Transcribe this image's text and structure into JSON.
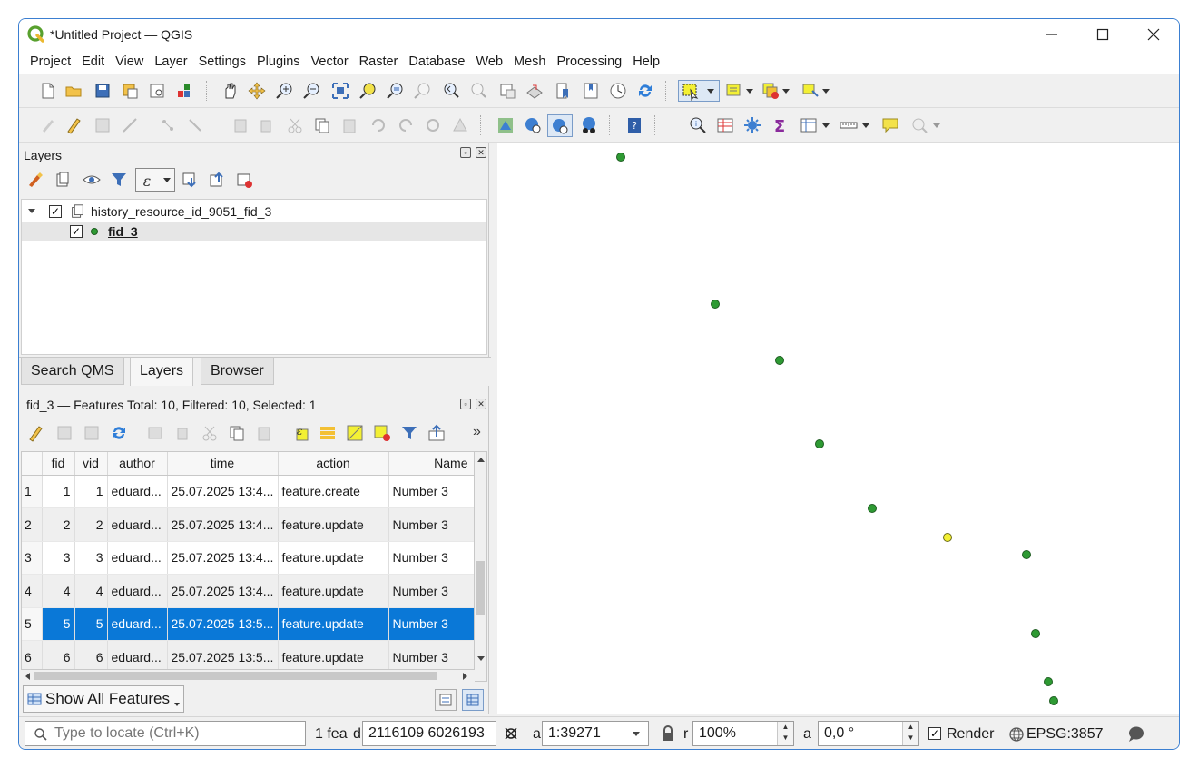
{
  "window": {
    "title": "*Untitled Project — QGIS"
  },
  "menubar": {
    "items": [
      "Project",
      "Edit",
      "View",
      "Layer",
      "Settings",
      "Plugins",
      "Vector",
      "Raster",
      "Database",
      "Web",
      "Mesh",
      "Processing",
      "Help"
    ]
  },
  "layers_panel": {
    "title": "Layers",
    "group": {
      "name": "history_resource_id_9051_fid_3",
      "checked": "✓"
    },
    "layer": {
      "name": "fid_3",
      "checked": "✓"
    }
  },
  "panel_tabs": [
    "Search QMS",
    "Layers",
    "Browser"
  ],
  "attribute_table": {
    "title": "fid_3 — Features Total: 10, Filtered: 10, Selected: 1",
    "columns": [
      "fid",
      "vid",
      "author",
      "time",
      "action",
      "Name"
    ],
    "rows": [
      {
        "row": "1",
        "fid": "1",
        "vid": "1",
        "author": "eduard...",
        "time": "25.07.2025 13:4...",
        "action": "feature.create",
        "name": "Number 3"
      },
      {
        "row": "2",
        "fid": "2",
        "vid": "2",
        "author": "eduard...",
        "time": "25.07.2025 13:4...",
        "action": "feature.update",
        "name": "Number 3"
      },
      {
        "row": "3",
        "fid": "3",
        "vid": "3",
        "author": "eduard...",
        "time": "25.07.2025 13:4...",
        "action": "feature.update",
        "name": "Number 3"
      },
      {
        "row": "4",
        "fid": "4",
        "vid": "4",
        "author": "eduard...",
        "time": "25.07.2025 13:4...",
        "action": "feature.update",
        "name": "Number 3"
      },
      {
        "row": "5",
        "fid": "5",
        "vid": "5",
        "author": "eduard...",
        "time": "25.07.2025 13:5...",
        "action": "feature.update",
        "name": "Number 3"
      },
      {
        "row": "6",
        "fid": "6",
        "vid": "6",
        "author": "eduard...",
        "time": "25.07.2025 13:5...",
        "action": "feature.update",
        "name": "Number 3"
      }
    ],
    "selected_row": "5",
    "show_all_label": "Show All Features",
    "overflow_glyph": "»"
  },
  "statusbar": {
    "locator_placeholder": "Type to locate (Ctrl+K)",
    "feature_label": "1 fea",
    "coord_label": "d",
    "coordinate": "2116109  6026193",
    "scale_label": "a",
    "scale": "1:39271",
    "magnifier_label": "r",
    "magnifier": "100%",
    "rotation_label": "a",
    "rotation": "0,0 °",
    "render_label": "Render",
    "crs": "EPSG:3857"
  },
  "colors": {
    "selection": "#0a78d7",
    "point_fill": "#2e9a33",
    "selected_point_fill": "#f3f034",
    "window_border": "#3b7fd1"
  }
}
